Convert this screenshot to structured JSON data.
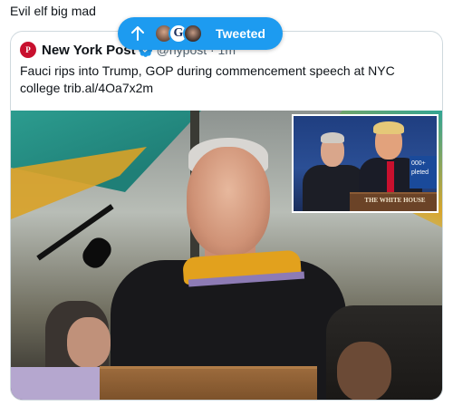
{
  "tweet": {
    "text": "Evil elf big mad"
  },
  "quoted_tweet": {
    "author_name": "New York Post",
    "logo_text": "P",
    "verified": true,
    "handle_time": "@nypost · 1m",
    "body": "Fauci rips into Trump, GOP during commencement speech at NYC college trib.al/4Oa7x2m",
    "inset_screen_text": "000+ pleted",
    "inset_podium_text": "THE WHITE HOUSE"
  },
  "toast": {
    "label": "Tweeted",
    "avatar_letter": "G",
    "color": "#1d9bf0"
  }
}
